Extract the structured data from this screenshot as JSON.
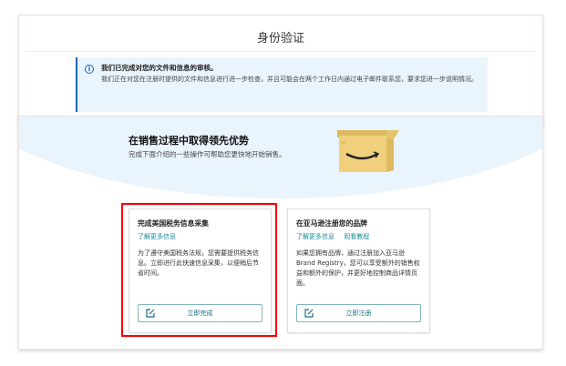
{
  "identity": {
    "title": "身份验证",
    "alert": {
      "icon": "info-icon",
      "title": "我们已完成对您的文件和信息的审核。",
      "body": "我们正在对您在注册时提供的文件和信息进行进一步检查，并且可能会在两个工作日内通过电子邮件联系您，要求您进一步说明情况。"
    }
  },
  "promo": {
    "title": "在销售过程中取得领先优势",
    "subtitle": "完成下面介绍的一些操作可帮助您更快地开始销售。",
    "cards": [
      {
        "title": "完成美国税务信息采集",
        "links": [
          "了解更多信息"
        ],
        "description": "为了遵守美国税务法规，您需要提供税务信息。立即进行此快速信息采集，以便稍后节省时间。",
        "button": "立即完成",
        "highlighted": true
      },
      {
        "title": "在亚马逊注册您的品牌",
        "links": [
          "了解更多信息",
          "观看教程"
        ],
        "description": "如果您拥有品牌，通过注册加入亚马逊 Brand Registry，您可以享受额外的销售权益和额外的保护，并更好地控制商品详情页面。",
        "button": "立即注册",
        "highlighted": false
      }
    ]
  },
  "colors": {
    "accent": "#1a65b8",
    "link": "#1a8a9a",
    "highlight": "#ff0000",
    "hero_bg": "#eaf4fd",
    "box": "#f0d07c"
  }
}
